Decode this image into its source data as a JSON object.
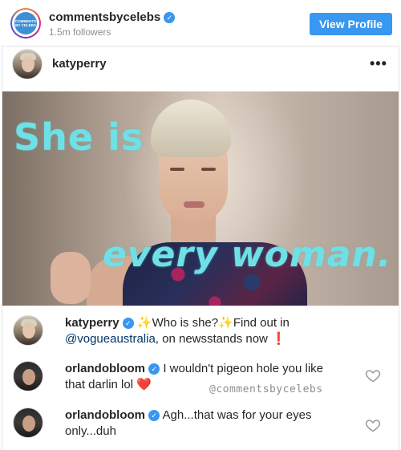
{
  "header": {
    "account_name": "commentsbycelebs",
    "followers": "1.5m followers",
    "logo_text": "COMMENTS BY CELEBS",
    "view_profile_label": "View Profile"
  },
  "post": {
    "username": "katyperry",
    "more_icon": "•••",
    "image_overlay": {
      "line1": "She is",
      "line2": "every woman."
    }
  },
  "comments": [
    {
      "author": "katyperry",
      "verified": true,
      "sparkle1": "✨",
      "part1": "Who is she?",
      "sparkle2": "✨",
      "part2": "Find out in",
      "mention": "@vogueaustralia",
      "part3": ", on newsstands now",
      "emoji": "❗"
    },
    {
      "author": "orlandobloom",
      "verified": true,
      "text": "I wouldn't pigeon hole you like that darlin lol",
      "emoji": "❤️"
    },
    {
      "author": "orlandobloom",
      "verified": true,
      "text": "Agh...that was for your eyes only...duh"
    }
  ],
  "watermark": "@commentsbycelebs",
  "colors": {
    "accent": "#3897f0",
    "overlay_text": "#6fe0e6",
    "mention": "#003569"
  }
}
